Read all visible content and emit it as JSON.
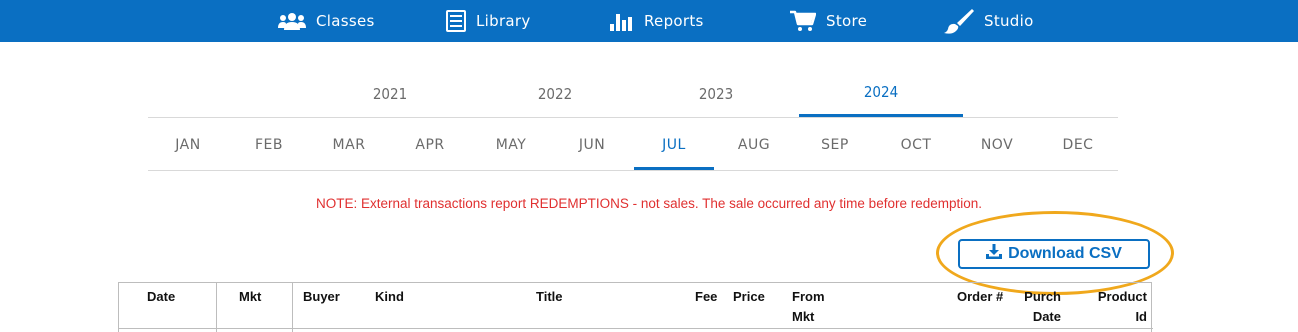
{
  "nav": {
    "classes": "Classes",
    "library": "Library",
    "reports": "Reports",
    "store": "Store",
    "studio": "Studio"
  },
  "years": [
    "2021",
    "2022",
    "2023",
    "2024"
  ],
  "active_year": "2024",
  "months": [
    "JAN",
    "FEB",
    "MAR",
    "APR",
    "MAY",
    "JUN",
    "JUL",
    "AUG",
    "SEP",
    "OCT",
    "NOV",
    "DEC"
  ],
  "active_month": "JUL",
  "note": "NOTE: External transactions report REDEMPTIONS - not sales. The sale occurred any time before redemption.",
  "download_label": "Download CSV",
  "table": {
    "headers": {
      "date": "Date",
      "mkt": "Mkt",
      "buyer": "Buyer",
      "kind": "Kind",
      "title": "Title",
      "fee": "Fee",
      "price": "Price",
      "from_mkt_1": "From",
      "from_mkt_2": "Mkt",
      "order": "Order #",
      "purch_date_1": "Purch",
      "purch_date_2": "Date",
      "product_id_1": "Product",
      "product_id_2": "Id"
    }
  },
  "colors": {
    "brand": "#0a6fc2",
    "note": "#e03030",
    "highlight": "#f0a81c"
  }
}
